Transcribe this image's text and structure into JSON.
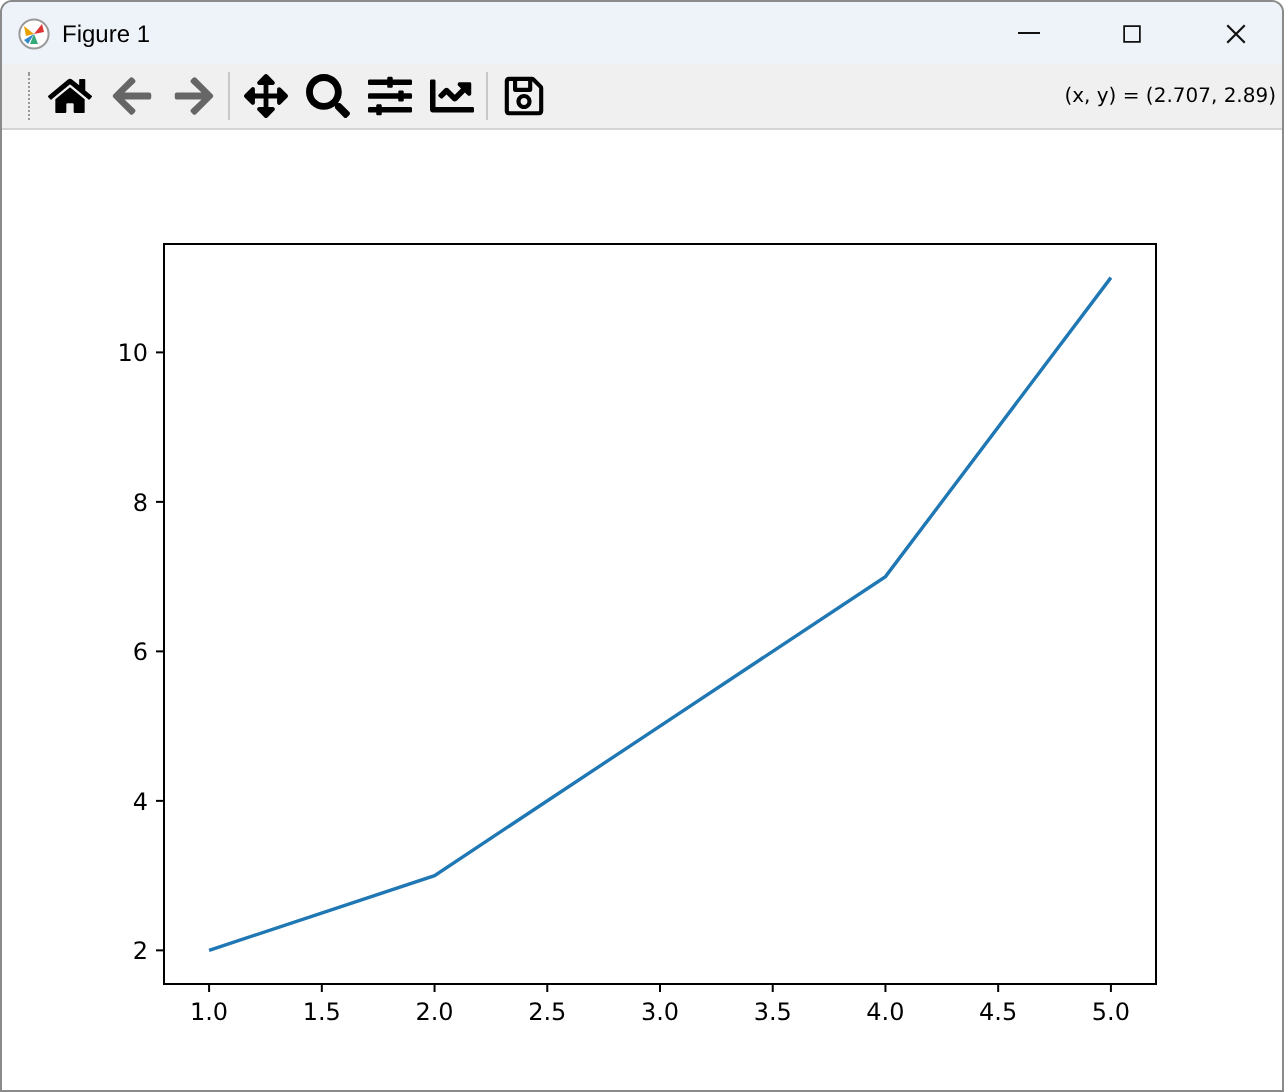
{
  "window": {
    "title": "Figure 1"
  },
  "toolbar": {
    "buttons": [
      {
        "disabled": false
      },
      {
        "disabled": true
      },
      {
        "disabled": true
      },
      {
        "disabled": false
      },
      {
        "disabled": false
      },
      {
        "disabled": false
      },
      {
        "disabled": false
      },
      {
        "disabled": false
      }
    ],
    "coordinates": "(x, y) = (2.707, 2.89)"
  },
  "figure": {
    "chart_data": {
      "type": "line",
      "x": [
        1,
        2,
        3,
        4,
        5
      ],
      "series": [
        {
          "color": "#1f77b4",
          "values": [
            2,
            3,
            5,
            7,
            11
          ]
        }
      ],
      "xlim": [
        0.8,
        5.2
      ],
      "ylim": [
        1.55,
        11.45
      ],
      "xticks": [
        {
          "value": 1,
          "label": "1.0"
        },
        {
          "value": 1.5,
          "label": "1.5"
        },
        {
          "value": 2,
          "label": "2.0"
        },
        {
          "value": 2.5,
          "label": "2.5"
        },
        {
          "value": 3,
          "label": "3.0"
        },
        {
          "value": 3.5,
          "label": "3.5"
        },
        {
          "value": 4,
          "label": "4.0"
        },
        {
          "value": 4.5,
          "label": "4.5"
        },
        {
          "value": 5,
          "label": "5.0"
        }
      ],
      "yticks": [
        2,
        4,
        6,
        8,
        10
      ]
    }
  }
}
